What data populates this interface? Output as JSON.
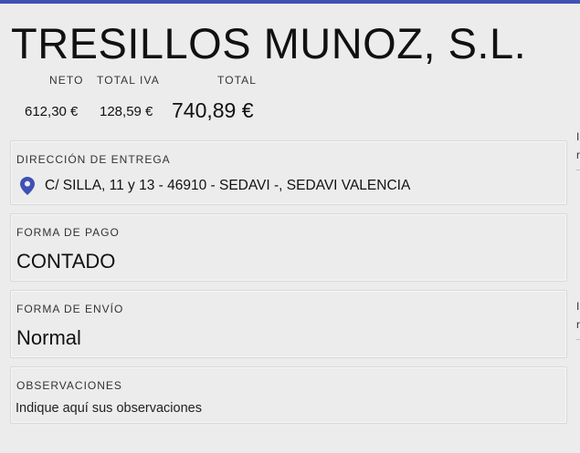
{
  "header": {
    "accent_color": "#3f51b5",
    "company_name": "TRESILLOS MUNOZ, S.L."
  },
  "totals": {
    "neto_label": "NETO",
    "neto_value": "612,30 €",
    "iva_label": "TOTAL IVA",
    "iva_value": "128,59 €",
    "total_label": "TOTAL",
    "total_value": "740,89 €"
  },
  "delivery": {
    "label": "DIRECCIÓN DE ENTREGA",
    "icon": "location-pin-icon",
    "address": "C/ SILLA, 11 y 13 - 46910 - SEDAVI -, SEDAVI VALENCIA"
  },
  "payment": {
    "label": "FORMA DE PAGO",
    "value": "CONTADO"
  },
  "shipping": {
    "label": "FORMA DE ENVÍO",
    "value": "Normal"
  },
  "notes": {
    "label": "OBSERVACIONES",
    "placeholder": "Indique aquí sus observaciones"
  },
  "edge_fragments": {
    "a1": "I",
    "a2": "r",
    "b1": "I",
    "b2": "r"
  }
}
